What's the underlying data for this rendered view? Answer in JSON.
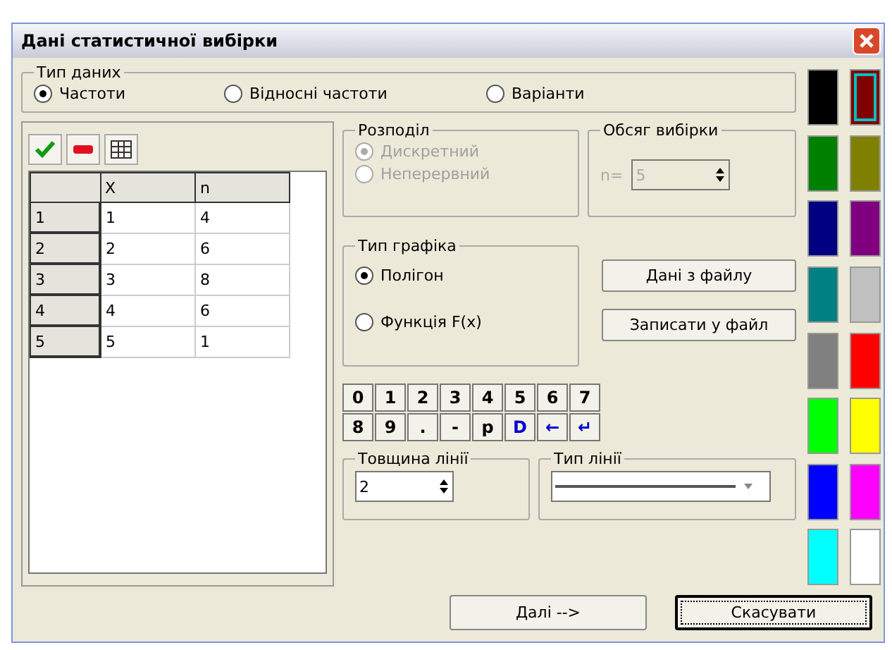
{
  "window": {
    "title": "Дані статистичної вибірки"
  },
  "data_type": {
    "label": "Тип даних",
    "options": [
      {
        "label": "Частоти",
        "selected": true
      },
      {
        "label": "Відносні частоти",
        "selected": false
      },
      {
        "label": "Варіанти",
        "selected": false
      }
    ]
  },
  "table": {
    "columns": [
      "X",
      "n"
    ],
    "rows": [
      {
        "index": "1",
        "cells": [
          "1",
          "4"
        ]
      },
      {
        "index": "2",
        "cells": [
          "2",
          "6"
        ]
      },
      {
        "index": "3",
        "cells": [
          "3",
          "8"
        ]
      },
      {
        "index": "4",
        "cells": [
          "4",
          "6"
        ]
      },
      {
        "index": "5",
        "cells": [
          "5",
          "1"
        ]
      }
    ]
  },
  "distribution": {
    "label": "Розподіл",
    "disabled": true,
    "options": [
      {
        "label": "Дискретний",
        "selected": true
      },
      {
        "label": "Неперервний",
        "selected": false
      }
    ]
  },
  "sample_size": {
    "label": "Обсяг вибірки",
    "prefix": "n=",
    "value": "5",
    "disabled": true
  },
  "chart_type": {
    "label": "Тип графіка",
    "options": [
      {
        "label": "Полігон",
        "selected": true
      },
      {
        "label": "Функція F(x)",
        "selected": false
      }
    ]
  },
  "file_buttons": [
    "Дані з файлу",
    "Записати у файл"
  ],
  "keypad": [
    {
      "label": "0",
      "kind": "plain"
    },
    {
      "label": "1",
      "kind": "plain"
    },
    {
      "label": "2",
      "kind": "plain"
    },
    {
      "label": "3",
      "kind": "plain"
    },
    {
      "label": "4",
      "kind": "plain"
    },
    {
      "label": "5",
      "kind": "plain"
    },
    {
      "label": "6",
      "kind": "plain"
    },
    {
      "label": "7",
      "kind": "plain"
    },
    {
      "label": "8",
      "kind": "plain"
    },
    {
      "label": "9",
      "kind": "plain"
    },
    {
      "label": ".",
      "kind": "plain"
    },
    {
      "label": "-",
      "kind": "plain"
    },
    {
      "label": "p",
      "kind": "plain"
    },
    {
      "label": "D",
      "kind": "action"
    },
    {
      "label": "←",
      "kind": "action"
    },
    {
      "label": "↵",
      "kind": "action"
    }
  ],
  "line_width": {
    "label": "Товщина лінії",
    "value": "2"
  },
  "line_type": {
    "label": "Тип лінії"
  },
  "palette": [
    {
      "color": "#000000",
      "selected": false
    },
    {
      "color": "#800000",
      "selected": true
    },
    {
      "color": "#008000",
      "selected": false
    },
    {
      "color": "#808000",
      "selected": false
    },
    {
      "color": "#000080",
      "selected": false
    },
    {
      "color": "#800080",
      "selected": false
    },
    {
      "color": "#008080",
      "selected": false
    },
    {
      "color": "#c0c0c0",
      "selected": false
    },
    {
      "color": "#808080",
      "selected": false
    },
    {
      "color": "#ff0000",
      "selected": false
    },
    {
      "color": "#00ff00",
      "selected": false
    },
    {
      "color": "#ffff00",
      "selected": false
    },
    {
      "color": "#0000ff",
      "selected": false
    },
    {
      "color": "#ff00ff",
      "selected": false
    },
    {
      "color": "#00ffff",
      "selected": false
    },
    {
      "color": "#ffffff",
      "selected": false
    }
  ],
  "footer": [
    {
      "label": "Далі -->",
      "default": false
    },
    {
      "label": "Скасувати",
      "default": true
    }
  ]
}
